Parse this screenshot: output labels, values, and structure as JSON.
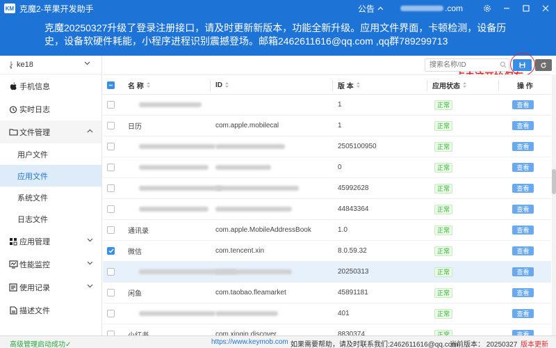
{
  "titlebar": {
    "logo_text": "KM",
    "title": "克魔2-苹果开发助手",
    "notice_label": "公告",
    "account_suffix": ".com"
  },
  "banner": {
    "text": "克魔20250327升级了登录注册接口，请及时更新新版本，功能全新升级。应用文件界面，卡顿检测，设备历史，设备软硬件耗能，小程序进程识别震撼登场。邮箱2462611616@qq.com ,qq群789299713"
  },
  "sidebar": {
    "device": "ke18",
    "items": [
      {
        "label": "手机信息",
        "icon": "apple-icon"
      },
      {
        "label": "实时日志",
        "icon": "log-icon"
      },
      {
        "label": "文件管理",
        "icon": "folder-icon",
        "open": true
      },
      {
        "label": "应用管理",
        "icon": "grid-icon"
      },
      {
        "label": "性能监控",
        "icon": "monitor-icon"
      },
      {
        "label": "使用记录",
        "icon": "list-icon"
      },
      {
        "label": "描述文件",
        "icon": "document-icon"
      }
    ],
    "sub_items": [
      "用户文件",
      "应用文件",
      "系统文件",
      "日志文件"
    ]
  },
  "toolbar": {
    "search_placeholder": "搜索名称/ID",
    "annotation": "点击这开始保存"
  },
  "table": {
    "headers": {
      "name": "名 称",
      "id": "ID",
      "version": "版 本",
      "status": "应用状态",
      "action": "操 作"
    },
    "rows": [
      {
        "name": "",
        "id": "",
        "version": "1",
        "status": "正常",
        "action": "查看",
        "checked": false,
        "blurName": true,
        "blurId": false
      },
      {
        "name": "日历",
        "id": "com.apple.mobilecal",
        "version": "1",
        "status": "正常",
        "action": "查看",
        "checked": false,
        "blurName": false,
        "blurId": false
      },
      {
        "name": "",
        "id": "",
        "version": "2505100950",
        "status": "正常",
        "action": "查看",
        "checked": false,
        "blurName": true,
        "blurId": true
      },
      {
        "name": "",
        "id": "",
        "version": "0",
        "status": "正常",
        "action": "查看",
        "checked": false,
        "blurName": true,
        "blurId": true
      },
      {
        "name": "",
        "id": "",
        "version": "45992628",
        "status": "正常",
        "action": "查看",
        "checked": false,
        "blurName": true,
        "blurId": true
      },
      {
        "name": "",
        "id": "",
        "version": "44843364",
        "status": "正常",
        "action": "查看",
        "checked": false,
        "blurName": true,
        "blurId": true
      },
      {
        "name": "通讯录",
        "id": "com.apple.MobileAddressBook",
        "version": "1.0",
        "status": "正常",
        "action": "查看",
        "checked": false,
        "blurName": false,
        "blurId": false
      },
      {
        "name": "微信",
        "id": "com.tencent.xin",
        "version": "8.0.59.32",
        "status": "正常",
        "action": "查看",
        "checked": true,
        "blurName": false,
        "blurId": false
      },
      {
        "name": "",
        "id": "",
        "version": "20250313",
        "status": "正常",
        "action": "查看",
        "checked": false,
        "blurName": true,
        "blurId": true,
        "selected": true
      },
      {
        "name": "闲鱼",
        "id": "com.taobao.fleamarket",
        "version": "45891181",
        "status": "正常",
        "action": "查看",
        "checked": false,
        "blurName": false,
        "blurId": false
      },
      {
        "name": "",
        "id": "",
        "version": "401",
        "status": "正常",
        "action": "查看",
        "checked": false,
        "blurName": true,
        "blurId": true
      },
      {
        "name": "小红书",
        "id": "com.xingin.discover",
        "version": "8830374",
        "status": "正常",
        "action": "查看",
        "checked": false,
        "blurName": false,
        "blurId": false
      }
    ]
  },
  "statusbar": {
    "left": "高级管理启动成功✓",
    "link": "https://www.keymob.com",
    "help": "如果需要帮助，请及时联系我们:2462611616@qq.com",
    "version": "当前版本：  20250327",
    "update": "版本更新"
  },
  "colors": {
    "brand": "#1e73d6",
    "accent": "#3a8ee6",
    "status_ok": "#2db839",
    "annotation": "#e4262e"
  }
}
